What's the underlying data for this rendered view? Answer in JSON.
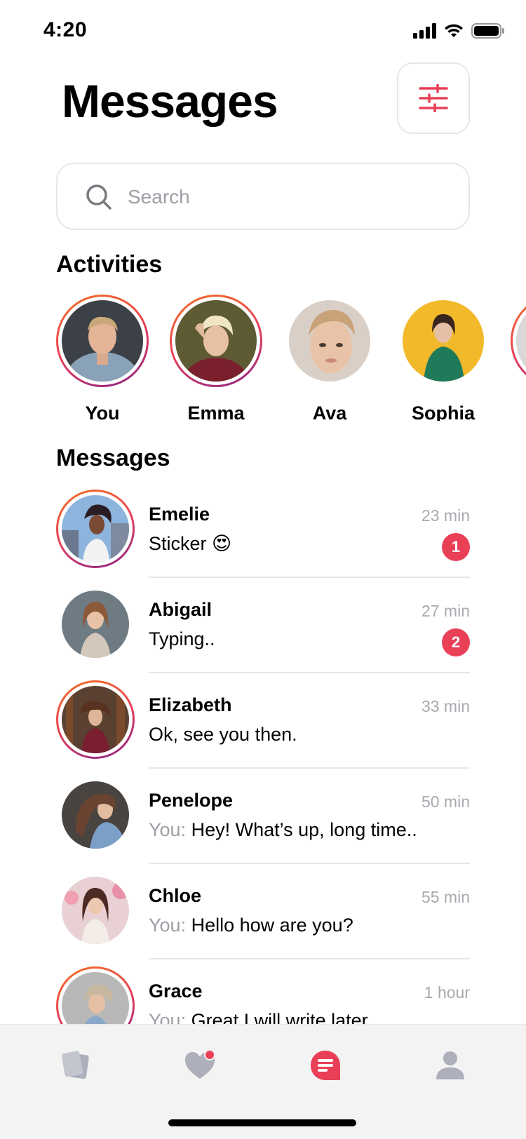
{
  "status_bar": {
    "time": "4:20"
  },
  "header": {
    "title": "Messages"
  },
  "search": {
    "placeholder": "Search"
  },
  "activities": {
    "title": "Activities",
    "items": [
      {
        "name": "You",
        "active": true
      },
      {
        "name": "Emma",
        "active": true
      },
      {
        "name": "Ava",
        "active": false
      },
      {
        "name": "Sophia",
        "active": false
      },
      {
        "name": "",
        "active": true
      }
    ]
  },
  "messages": {
    "title": "Messages",
    "items": [
      {
        "name": "Emelie",
        "time": "23 min",
        "prefix": "",
        "preview": "Sticker 😍",
        "unread": "1",
        "active": true
      },
      {
        "name": "Abigail",
        "time": "27 min",
        "prefix": "",
        "preview": "Typing..",
        "unread": "2",
        "active": false
      },
      {
        "name": "Elizabeth",
        "time": "33 min",
        "prefix": "",
        "preview": "Ok, see you then.",
        "unread": "",
        "active": true
      },
      {
        "name": "Penelope",
        "time": "50 min",
        "prefix": "You: ",
        "preview": "Hey! What’s up, long time..",
        "unread": "",
        "active": false
      },
      {
        "name": "Chloe",
        "time": "55 min",
        "prefix": "You: ",
        "preview": "Hello how are you?",
        "unread": "",
        "active": false
      },
      {
        "name": "Grace",
        "time": "1 hour",
        "prefix": "You: ",
        "preview": "Great I will write later",
        "unread": "",
        "active": true
      }
    ]
  },
  "bottom_nav": [
    {
      "icon": "cards-icon"
    },
    {
      "icon": "heart-icon"
    },
    {
      "icon": "chat-icon"
    },
    {
      "icon": "profile-icon"
    }
  ],
  "colors": {
    "accent": "#e94057",
    "inactive_icon": "#adafbb",
    "divider": "#e8e6ea"
  }
}
